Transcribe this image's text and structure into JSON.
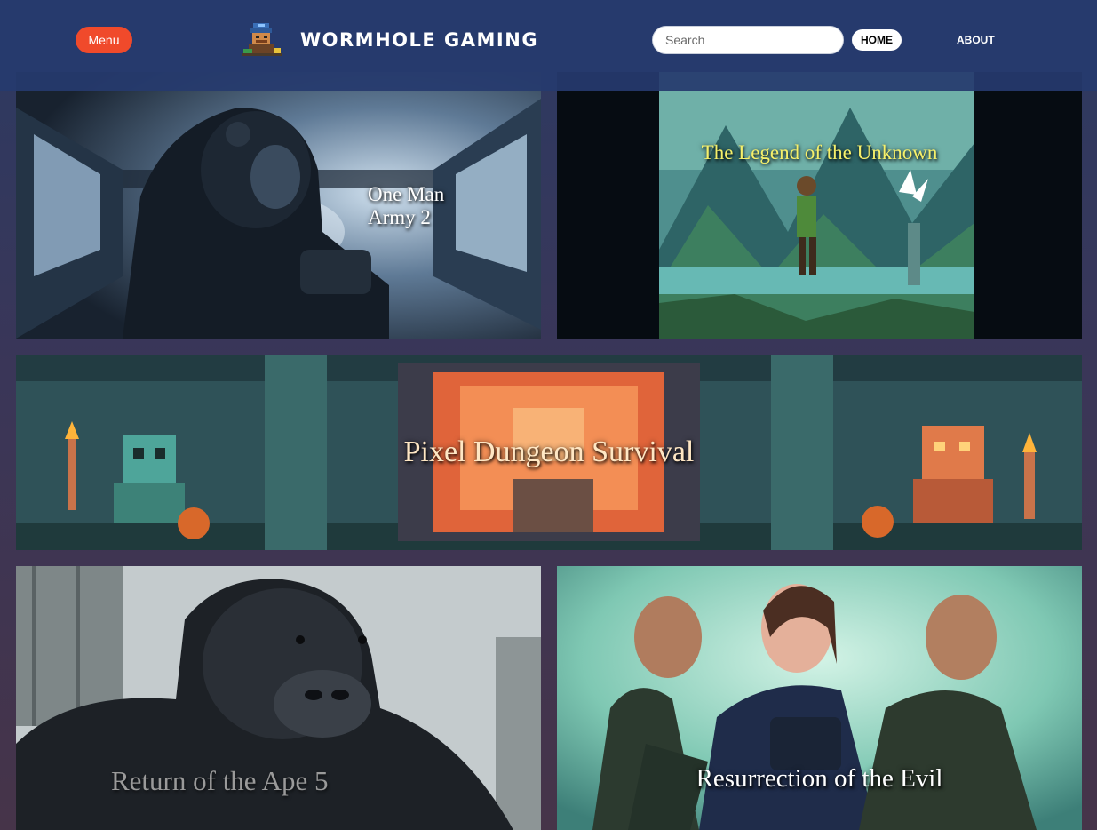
{
  "header": {
    "menu_label": "Menu",
    "logo_icon": "pixel-miner-icon",
    "site_title": "WORMHOLE GAMING",
    "search_placeholder": "Search",
    "search_value": "",
    "home_label": "HOME",
    "about_label": "ABOUT",
    "colors": {
      "header_bg": "#263a6e",
      "menu_button": "#f04a2b"
    }
  },
  "games": [
    {
      "title_line1": "One Man",
      "title_line2": "Army 2"
    },
    {
      "title": "The Legend of the Unknown"
    },
    {
      "title": "Pixel Dungeon Survival"
    },
    {
      "title": "Return of the Ape 5"
    },
    {
      "title": "Resurrection of the Evil"
    }
  ]
}
